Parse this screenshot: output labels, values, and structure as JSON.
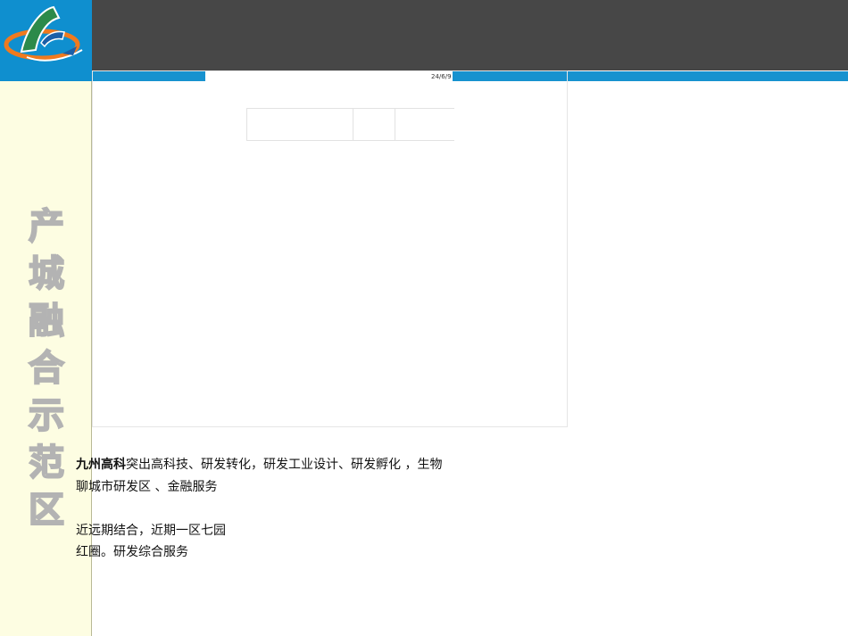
{
  "colors": {
    "header_dark": "#474747",
    "accent_blue": "#1792cf",
    "sidebar_bg": "#fdfde2"
  },
  "logo": {
    "icon": "company-logo-icon"
  },
  "sidebar": {
    "title_chars": [
      "产",
      "城",
      "融",
      "合",
      "示",
      "范",
      "区"
    ]
  },
  "slide": {
    "date": "24/6/9"
  },
  "content": {
    "line1_bold": "九州高科",
    "line1_rest": "突出高科技、研发转化，研发工业设计、研发孵化 ，生物",
    "line2": "聊城市研发区 、金融服务",
    "line3": "近远期结合，近期一区七园",
    "line4": "红圈。研发综合服务"
  }
}
